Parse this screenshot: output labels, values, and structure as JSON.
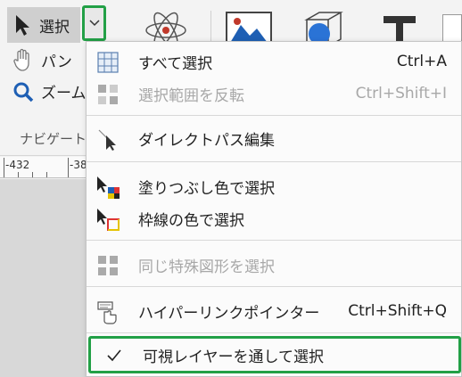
{
  "ribbon": {
    "select_label": "選択",
    "pan_label": "パン",
    "zoom_label": "ズーム",
    "navigate_label": "ナビゲート"
  },
  "ruler": {
    "ticks": [
      "-432",
      "-38"
    ]
  },
  "menu": {
    "items": [
      {
        "label": "すべて選択",
        "shortcut": "Ctrl+A",
        "icon": "select-all-icon"
      },
      {
        "label": "選択範囲を反転",
        "shortcut": "Ctrl+Shift+I",
        "icon": "invert-selection-icon"
      },
      {
        "label": "ダイレクトパス編集",
        "icon": "direct-path-edit-icon"
      },
      {
        "label": "塗りつぶし色で選択",
        "icon": "select-by-fill-icon"
      },
      {
        "label": "枠線の色で選択",
        "icon": "select-by-stroke-icon"
      },
      {
        "label": "同じ特殊図形を選択",
        "icon": "select-same-shape-icon"
      },
      {
        "label": "ハイパーリンクポインター",
        "shortcut": "Ctrl+Shift+Q",
        "icon": "hyperlink-pointer-icon"
      },
      {
        "label": "可視レイヤーを通して選択",
        "icon": "check-icon"
      }
    ]
  },
  "colors": {
    "highlight": "#22a046",
    "accent_blue": "#1e5fb4"
  }
}
